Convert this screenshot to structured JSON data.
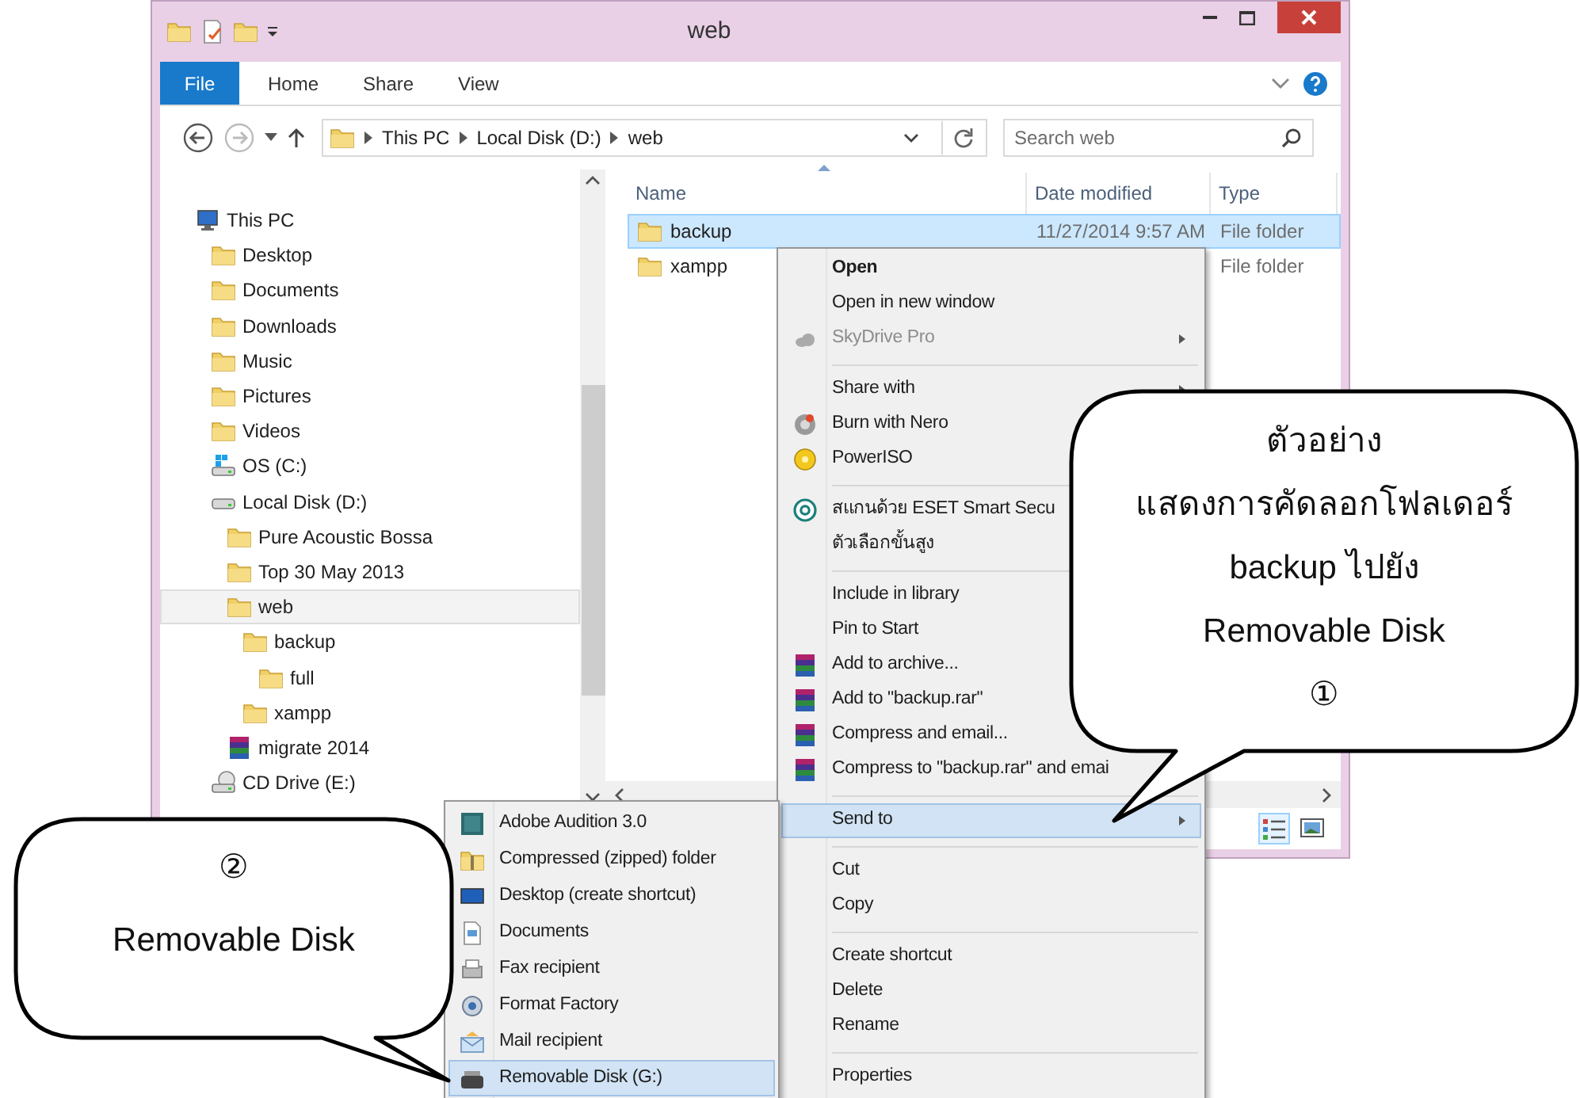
{
  "window": {
    "title": "web"
  },
  "ribbon": {
    "file_tab": "File",
    "tabs": [
      "Home",
      "Share",
      "View"
    ]
  },
  "address": {
    "path": [
      "This PC",
      "Local Disk (D:)",
      "web"
    ]
  },
  "search": {
    "placeholder": "Search web"
  },
  "nav_tree": [
    {
      "label": "This PC",
      "kind": "pc",
      "selected": false,
      "children": [
        {
          "label": "Desktop",
          "kind": "folder",
          "selected": false
        },
        {
          "label": "Documents",
          "kind": "folder",
          "selected": false
        },
        {
          "label": "Downloads",
          "kind": "folder",
          "selected": false
        },
        {
          "label": "Music",
          "kind": "folder",
          "selected": false
        },
        {
          "label": "Pictures",
          "kind": "folder",
          "selected": false
        },
        {
          "label": "Videos",
          "kind": "folder",
          "selected": false
        },
        {
          "label": "OS (C:)",
          "kind": "os",
          "selected": false
        },
        {
          "label": "Local Disk (D:)",
          "kind": "drive",
          "selected": false,
          "children": [
            {
              "label": "Pure Acoustic Bossa",
              "kind": "folder",
              "selected": false
            },
            {
              "label": "Top 30 May 2013",
              "kind": "folder",
              "selected": false
            },
            {
              "label": "web",
              "kind": "folder",
              "selected": true,
              "children": [
                {
                  "label": "backup",
                  "kind": "folder",
                  "selected": false,
                  "children": [
                    {
                      "label": "full",
                      "kind": "folder",
                      "selected": false
                    }
                  ]
                },
                {
                  "label": "xampp",
                  "kind": "folder",
                  "selected": false
                }
              ]
            },
            {
              "label": "migrate 2014",
              "kind": "archive",
              "selected": false
            }
          ]
        },
        {
          "label": "CD Drive (E:)",
          "kind": "cd",
          "selected": false
        }
      ]
    }
  ],
  "file_list": {
    "columns": [
      "Name",
      "Date modified",
      "Type"
    ],
    "rows": [
      {
        "name": "backup",
        "date_modified": "11/27/2014 9:57 AM",
        "type": "File folder",
        "selected": true
      },
      {
        "name": "xampp",
        "type": "File folder",
        "selected": false
      }
    ]
  },
  "context_menu": {
    "groups": [
      [
        {
          "label": "Open",
          "default": true,
          "disabled": false,
          "submenu": false,
          "selected": false
        },
        {
          "label": "Open in new window",
          "default": false,
          "disabled": false,
          "submenu": false,
          "selected": false
        },
        {
          "label": "SkyDrive Pro",
          "kind": "cloud",
          "default": false,
          "disabled": true,
          "submenu": true,
          "selected": false
        }
      ],
      [
        {
          "label": "Share with",
          "default": false,
          "disabled": false,
          "submenu": true,
          "selected": false
        },
        {
          "label": "Burn with Nero",
          "kind": "nero",
          "default": false,
          "disabled": false,
          "submenu": false,
          "selected": false
        },
        {
          "label": "PowerISO",
          "kind": "poweriso",
          "default": false,
          "disabled": false,
          "submenu": false,
          "selected": false
        }
      ],
      [
        {
          "label": "สแกนด้วย ESET Smart Secu",
          "kind": "eset",
          "default": false,
          "disabled": false,
          "submenu": false,
          "selected": false
        },
        {
          "label": "ตัวเลือกขั้นสูง",
          "default": false,
          "disabled": false,
          "submenu": false,
          "selected": false
        }
      ],
      [
        {
          "label": "Include in library",
          "default": false,
          "disabled": false,
          "submenu": false,
          "selected": false
        },
        {
          "label": "Pin to Start",
          "default": false,
          "disabled": false,
          "submenu": false,
          "selected": false
        },
        {
          "label": "Add to archive...",
          "kind": "archive",
          "default": false,
          "disabled": false,
          "submenu": false,
          "selected": false
        },
        {
          "label": "Add to \"backup.rar\"",
          "kind": "archive",
          "default": false,
          "disabled": false,
          "submenu": false,
          "selected": false
        },
        {
          "label": "Compress and email...",
          "kind": "archive",
          "default": false,
          "disabled": false,
          "submenu": false,
          "selected": false
        },
        {
          "label": "Compress to \"backup.rar\" and emai",
          "kind": "archive",
          "default": false,
          "disabled": false,
          "submenu": false,
          "selected": false
        }
      ],
      [
        {
          "label": "Send to",
          "default": false,
          "disabled": false,
          "submenu": true,
          "selected": true
        }
      ],
      [
        {
          "label": "Cut",
          "default": false,
          "disabled": false,
          "submenu": false,
          "selected": false
        },
        {
          "label": "Copy",
          "default": false,
          "disabled": false,
          "submenu": false,
          "selected": false
        }
      ],
      [
        {
          "label": "Create shortcut",
          "default": false,
          "disabled": false,
          "submenu": false,
          "selected": false
        },
        {
          "label": "Delete",
          "default": false,
          "disabled": false,
          "submenu": false,
          "selected": false
        },
        {
          "label": "Rename",
          "default": false,
          "disabled": false,
          "submenu": false,
          "selected": false
        }
      ],
      [
        {
          "label": "Properties",
          "default": false,
          "disabled": false,
          "submenu": false,
          "selected": false
        }
      ]
    ]
  },
  "send_to_menu": {
    "items": [
      {
        "label": "Adobe Audition 3.0",
        "kind": "app",
        "selected": false
      },
      {
        "label": "Compressed (zipped) folder",
        "kind": "zip",
        "selected": false
      },
      {
        "label": "Desktop (create shortcut)",
        "kind": "desktop",
        "selected": false
      },
      {
        "label": "Documents",
        "kind": "doc",
        "selected": false
      },
      {
        "label": "Fax recipient",
        "kind": "fax",
        "selected": false
      },
      {
        "label": "Format Factory",
        "kind": "ff",
        "selected": false
      },
      {
        "label": "Mail recipient",
        "kind": "mail",
        "selected": false
      },
      {
        "label": "Removable Disk (G:)",
        "kind": "usb",
        "selected": true
      }
    ]
  },
  "callouts": [
    {
      "lines": [
        "ตัวอย่าง",
        "แสดงการคัดลอกโฟลเดอร์",
        "backup ไปยัง",
        "Removable Disk",
        "①"
      ]
    },
    {
      "lines": [
        "②",
        "Removable Disk"
      ]
    }
  ]
}
